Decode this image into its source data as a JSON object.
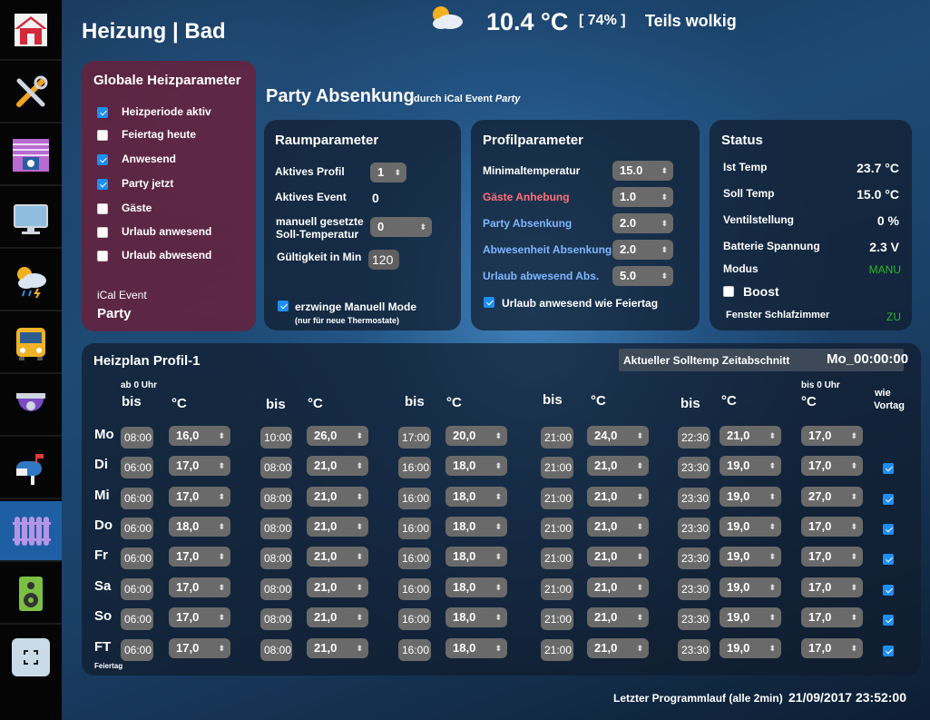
{
  "header": {
    "title": "Heizung | Bad",
    "weather_icon": "partly-cloudy-icon",
    "temperature": "10.4 °C",
    "humidity": "[ 74% ]",
    "condition": "Teils wolkig"
  },
  "sidebar": {
    "items": [
      {
        "name": "home-icon",
        "active": false
      },
      {
        "name": "tools-icon",
        "active": false
      },
      {
        "name": "blinds-icon",
        "active": false
      },
      {
        "name": "monitor-icon",
        "active": false
      },
      {
        "name": "weather-icon",
        "active": false
      },
      {
        "name": "bus-icon",
        "active": false
      },
      {
        "name": "camera-icon",
        "active": false
      },
      {
        "name": "mailbox-icon",
        "active": false
      },
      {
        "name": "radiator-icon",
        "active": true
      },
      {
        "name": "speaker-icon",
        "active": false
      },
      {
        "name": "fullscreen-icon",
        "active": false
      }
    ]
  },
  "globale": {
    "title": "Globale Heizparameter",
    "checkboxes": [
      {
        "label": "Heizperiode aktiv",
        "checked": true
      },
      {
        "label": "Feiertag heute",
        "checked": false
      },
      {
        "label": "Anwesend",
        "checked": true
      },
      {
        "label": "Party jetzt",
        "checked": true
      },
      {
        "label": "Gäste",
        "checked": false
      },
      {
        "label": "Urlaub anwesend",
        "checked": false
      },
      {
        "label": "Urlaub abwesend",
        "checked": false
      }
    ],
    "ical_label": "iCal Event",
    "ical_value": "Party"
  },
  "party": {
    "title": "Party Absenkung",
    "sub_prefix": "durch iCal Event",
    "sub_event": "Party"
  },
  "raum": {
    "title": "Raumparameter",
    "aktives_profil_label": "Aktives Profil",
    "aktives_profil_value": "1",
    "aktives_event_label": "Aktives Event",
    "aktives_event_value": "0",
    "manuell_label_1": "manuell gesetzte",
    "manuell_label_2": "Soll-Temperatur",
    "manuell_value": "0",
    "gueltigkeit_label": "Gültigkeit in Min",
    "gueltigkeit_value": "120",
    "erzwinge_label": "erzwinge Manuell Mode",
    "erzwinge_checked": true,
    "erzwinge_note": "(nur für neue Thermostate)"
  },
  "profil": {
    "title": "Profilparameter",
    "rows": [
      {
        "label": "Minimaltemperatur",
        "value": "15.0",
        "color": "#ffffff"
      },
      {
        "label": "Gäste Anhebung",
        "value": "1.0",
        "color": "#ff6f7a"
      },
      {
        "label": "Party Absenkung",
        "value": "2.0",
        "color": "#7fb6ff"
      },
      {
        "label": "Abwesenheit Absenkung",
        "value": "2.0",
        "color": "#7fb6ff"
      },
      {
        "label": "Urlaub abwesend Abs.",
        "value": "5.0",
        "color": "#7fb6ff"
      }
    ],
    "urlaub_label": "Urlaub anwesend wie Feiertag",
    "urlaub_checked": true
  },
  "status": {
    "title": "Status",
    "ist_label": "Ist Temp",
    "ist_value": "23.7 °C",
    "soll_label": "Soll Temp",
    "soll_value": "15.0 °C",
    "ventil_label": "Ventilstellung",
    "ventil_value": "0 %",
    "batterie_label": "Batterie Spannung",
    "batterie_value": "2.3 V",
    "modus_label": "Modus",
    "modus_value": "MANU",
    "boost_label": "Boost",
    "boost_checked": false,
    "fenster_label": "Fenster Schlafzimmer",
    "fenster_value": "ZU",
    "status_color": "#2fb52f"
  },
  "heizplan": {
    "title": "Heizplan Profil-1",
    "soll_label": "Aktueller Solltemp Zeitabschnitt",
    "soll_value": "Mo_00:00:00",
    "ab_label": "ab 0 Uhr",
    "bis0_label": "bis 0 Uhr",
    "wie_label_1": "wie",
    "wie_label_2": "Vortag",
    "bis": "bis",
    "celsius": "°C",
    "feiertag_note": "Feiertag",
    "rows": [
      {
        "day": "Mo",
        "t1": "08:00",
        "c1": "16,0",
        "t2": "10:00",
        "c2": "26,0",
        "t3": "17:00",
        "c3": "20,0",
        "t4": "21:00",
        "c4": "24,0",
        "t5": "22:30",
        "c5": "21,0",
        "c6": "17,0",
        "wie": null
      },
      {
        "day": "Di",
        "t1": "06:00",
        "c1": "17,0",
        "t2": "08:00",
        "c2": "21,0",
        "t3": "16:00",
        "c3": "18,0",
        "t4": "21:00",
        "c4": "21,0",
        "t5": "23:30",
        "c5": "19,0",
        "c6": "17,0",
        "wie": true
      },
      {
        "day": "Mi",
        "t1": "06:00",
        "c1": "17,0",
        "t2": "08:00",
        "c2": "21,0",
        "t3": "16:00",
        "c3": "18,0",
        "t4": "21:00",
        "c4": "21,0",
        "t5": "23:30",
        "c5": "19,0",
        "c6": "27,0",
        "wie": true
      },
      {
        "day": "Do",
        "t1": "06:00",
        "c1": "18,0",
        "t2": "08:00",
        "c2": "21,0",
        "t3": "16:00",
        "c3": "18,0",
        "t4": "21:00",
        "c4": "21,0",
        "t5": "23:30",
        "c5": "19,0",
        "c6": "17,0",
        "wie": true
      },
      {
        "day": "Fr",
        "t1": "06:00",
        "c1": "17,0",
        "t2": "08:00",
        "c2": "21,0",
        "t3": "16:00",
        "c3": "18,0",
        "t4": "21:00",
        "c4": "21,0",
        "t5": "23:30",
        "c5": "19,0",
        "c6": "17,0",
        "wie": true
      },
      {
        "day": "Sa",
        "t1": "06:00",
        "c1": "17,0",
        "t2": "08:00",
        "c2": "21,0",
        "t3": "16:00",
        "c3": "18,0",
        "t4": "21:00",
        "c4": "21,0",
        "t5": "23:30",
        "c5": "19,0",
        "c6": "17,0",
        "wie": true
      },
      {
        "day": "So",
        "t1": "06:00",
        "c1": "17,0",
        "t2": "08:00",
        "c2": "21,0",
        "t3": "16:00",
        "c3": "18,0",
        "t4": "21:00",
        "c4": "21,0",
        "t5": "23:30",
        "c5": "19,0",
        "c6": "17,0",
        "wie": true
      },
      {
        "day": "FT",
        "t1": "06:00",
        "c1": "17,0",
        "t2": "08:00",
        "c2": "21,0",
        "t3": "16:00",
        "c3": "18,0",
        "t4": "21:00",
        "c4": "21,0",
        "t5": "23:30",
        "c5": "19,0",
        "c6": "17,0",
        "wie": true
      }
    ]
  },
  "footer": {
    "letzter_label": "Letzter Programmlauf (alle 2min)",
    "datetime": "21/09/2017 23:52:00"
  }
}
